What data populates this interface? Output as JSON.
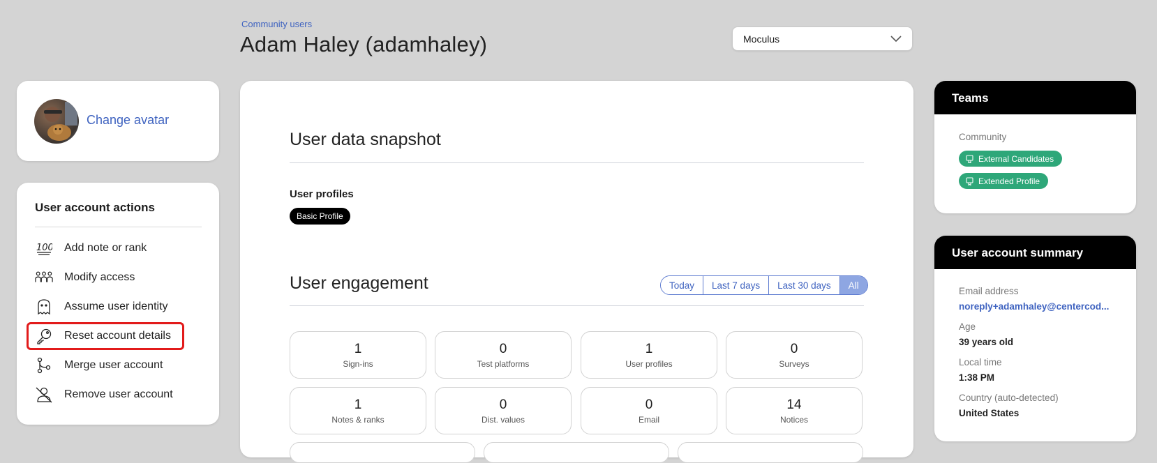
{
  "header": {
    "breadcrumb": "Community users",
    "title": "Adam Haley (adamhaley)",
    "project_select": {
      "value": "Moculus"
    }
  },
  "avatar_card": {
    "change_avatar": "Change avatar"
  },
  "actions": {
    "title": "User account actions",
    "items": [
      {
        "label": "Add note or rank",
        "icon": "hundred-points-icon"
      },
      {
        "label": "Modify access",
        "icon": "people-group-icon"
      },
      {
        "label": "Assume user identity",
        "icon": "ghost-icon"
      },
      {
        "label": "Reset account details",
        "icon": "key-icon"
      },
      {
        "label": "Merge user account",
        "icon": "merge-icon"
      },
      {
        "label": "Remove user account",
        "icon": "user-slash-icon"
      }
    ]
  },
  "snapshot": {
    "title": "User data snapshot",
    "profiles_label": "User profiles",
    "profiles": [
      "Basic Profile"
    ]
  },
  "engagement": {
    "title": "User engagement",
    "ranges": [
      "Today",
      "Last 7 days",
      "Last 30 days",
      "All"
    ],
    "active_range": "All",
    "stats": [
      {
        "value": "1",
        "label": "Sign-ins"
      },
      {
        "value": "0",
        "label": "Test platforms"
      },
      {
        "value": "1",
        "label": "User profiles"
      },
      {
        "value": "0",
        "label": "Surveys"
      },
      {
        "value": "1",
        "label": "Notes & ranks"
      },
      {
        "value": "0",
        "label": "Dist. values"
      },
      {
        "value": "0",
        "label": "Email"
      },
      {
        "value": "14",
        "label": "Notices"
      }
    ]
  },
  "teams": {
    "title": "Teams",
    "group_label": "Community",
    "badges": [
      "External Candidates",
      "Extended Profile"
    ]
  },
  "summary": {
    "title": "User account summary",
    "email_label": "Email address",
    "email_value": "noreply+adamhaley@centercod...",
    "age_label": "Age",
    "age_value": "39 years old",
    "time_label": "Local time",
    "time_value": "1:38 PM",
    "country_label": "Country (auto-detected)",
    "country_value": "United States"
  },
  "colors": {
    "link": "#3f63c0",
    "team_badge": "#2ea779",
    "highlight": "#e21b1b",
    "active_range": "#8ea6e2"
  }
}
